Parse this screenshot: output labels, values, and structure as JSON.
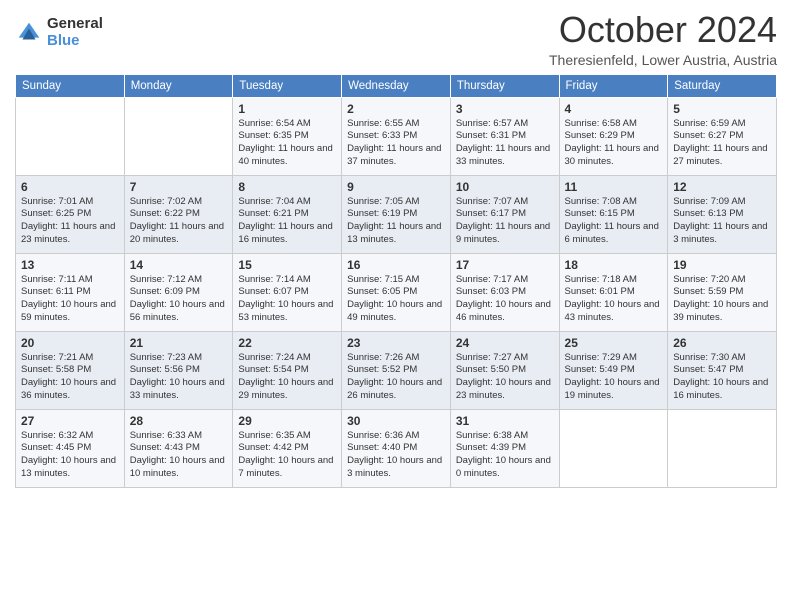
{
  "header": {
    "logo": {
      "general": "General",
      "blue": "Blue"
    },
    "title": "October 2024",
    "subtitle": "Theresienfeld, Lower Austria, Austria"
  },
  "weekdays": [
    "Sunday",
    "Monday",
    "Tuesday",
    "Wednesday",
    "Thursday",
    "Friday",
    "Saturday"
  ],
  "weeks": [
    [
      {
        "day": "",
        "sunrise": "",
        "sunset": "",
        "daylight": ""
      },
      {
        "day": "",
        "sunrise": "",
        "sunset": "",
        "daylight": ""
      },
      {
        "day": "1",
        "sunrise": "Sunrise: 6:54 AM",
        "sunset": "Sunset: 6:35 PM",
        "daylight": "Daylight: 11 hours and 40 minutes."
      },
      {
        "day": "2",
        "sunrise": "Sunrise: 6:55 AM",
        "sunset": "Sunset: 6:33 PM",
        "daylight": "Daylight: 11 hours and 37 minutes."
      },
      {
        "day": "3",
        "sunrise": "Sunrise: 6:57 AM",
        "sunset": "Sunset: 6:31 PM",
        "daylight": "Daylight: 11 hours and 33 minutes."
      },
      {
        "day": "4",
        "sunrise": "Sunrise: 6:58 AM",
        "sunset": "Sunset: 6:29 PM",
        "daylight": "Daylight: 11 hours and 30 minutes."
      },
      {
        "day": "5",
        "sunrise": "Sunrise: 6:59 AM",
        "sunset": "Sunset: 6:27 PM",
        "daylight": "Daylight: 11 hours and 27 minutes."
      }
    ],
    [
      {
        "day": "6",
        "sunrise": "Sunrise: 7:01 AM",
        "sunset": "Sunset: 6:25 PM",
        "daylight": "Daylight: 11 hours and 23 minutes."
      },
      {
        "day": "7",
        "sunrise": "Sunrise: 7:02 AM",
        "sunset": "Sunset: 6:22 PM",
        "daylight": "Daylight: 11 hours and 20 minutes."
      },
      {
        "day": "8",
        "sunrise": "Sunrise: 7:04 AM",
        "sunset": "Sunset: 6:21 PM",
        "daylight": "Daylight: 11 hours and 16 minutes."
      },
      {
        "day": "9",
        "sunrise": "Sunrise: 7:05 AM",
        "sunset": "Sunset: 6:19 PM",
        "daylight": "Daylight: 11 hours and 13 minutes."
      },
      {
        "day": "10",
        "sunrise": "Sunrise: 7:07 AM",
        "sunset": "Sunset: 6:17 PM",
        "daylight": "Daylight: 11 hours and 9 minutes."
      },
      {
        "day": "11",
        "sunrise": "Sunrise: 7:08 AM",
        "sunset": "Sunset: 6:15 PM",
        "daylight": "Daylight: 11 hours and 6 minutes."
      },
      {
        "day": "12",
        "sunrise": "Sunrise: 7:09 AM",
        "sunset": "Sunset: 6:13 PM",
        "daylight": "Daylight: 11 hours and 3 minutes."
      }
    ],
    [
      {
        "day": "13",
        "sunrise": "Sunrise: 7:11 AM",
        "sunset": "Sunset: 6:11 PM",
        "daylight": "Daylight: 10 hours and 59 minutes."
      },
      {
        "day": "14",
        "sunrise": "Sunrise: 7:12 AM",
        "sunset": "Sunset: 6:09 PM",
        "daylight": "Daylight: 10 hours and 56 minutes."
      },
      {
        "day": "15",
        "sunrise": "Sunrise: 7:14 AM",
        "sunset": "Sunset: 6:07 PM",
        "daylight": "Daylight: 10 hours and 53 minutes."
      },
      {
        "day": "16",
        "sunrise": "Sunrise: 7:15 AM",
        "sunset": "Sunset: 6:05 PM",
        "daylight": "Daylight: 10 hours and 49 minutes."
      },
      {
        "day": "17",
        "sunrise": "Sunrise: 7:17 AM",
        "sunset": "Sunset: 6:03 PM",
        "daylight": "Daylight: 10 hours and 46 minutes."
      },
      {
        "day": "18",
        "sunrise": "Sunrise: 7:18 AM",
        "sunset": "Sunset: 6:01 PM",
        "daylight": "Daylight: 10 hours and 43 minutes."
      },
      {
        "day": "19",
        "sunrise": "Sunrise: 7:20 AM",
        "sunset": "Sunset: 5:59 PM",
        "daylight": "Daylight: 10 hours and 39 minutes."
      }
    ],
    [
      {
        "day": "20",
        "sunrise": "Sunrise: 7:21 AM",
        "sunset": "Sunset: 5:58 PM",
        "daylight": "Daylight: 10 hours and 36 minutes."
      },
      {
        "day": "21",
        "sunrise": "Sunrise: 7:23 AM",
        "sunset": "Sunset: 5:56 PM",
        "daylight": "Daylight: 10 hours and 33 minutes."
      },
      {
        "day": "22",
        "sunrise": "Sunrise: 7:24 AM",
        "sunset": "Sunset: 5:54 PM",
        "daylight": "Daylight: 10 hours and 29 minutes."
      },
      {
        "day": "23",
        "sunrise": "Sunrise: 7:26 AM",
        "sunset": "Sunset: 5:52 PM",
        "daylight": "Daylight: 10 hours and 26 minutes."
      },
      {
        "day": "24",
        "sunrise": "Sunrise: 7:27 AM",
        "sunset": "Sunset: 5:50 PM",
        "daylight": "Daylight: 10 hours and 23 minutes."
      },
      {
        "day": "25",
        "sunrise": "Sunrise: 7:29 AM",
        "sunset": "Sunset: 5:49 PM",
        "daylight": "Daylight: 10 hours and 19 minutes."
      },
      {
        "day": "26",
        "sunrise": "Sunrise: 7:30 AM",
        "sunset": "Sunset: 5:47 PM",
        "daylight": "Daylight: 10 hours and 16 minutes."
      }
    ],
    [
      {
        "day": "27",
        "sunrise": "Sunrise: 6:32 AM",
        "sunset": "Sunset: 4:45 PM",
        "daylight": "Daylight: 10 hours and 13 minutes."
      },
      {
        "day": "28",
        "sunrise": "Sunrise: 6:33 AM",
        "sunset": "Sunset: 4:43 PM",
        "daylight": "Daylight: 10 hours and 10 minutes."
      },
      {
        "day": "29",
        "sunrise": "Sunrise: 6:35 AM",
        "sunset": "Sunset: 4:42 PM",
        "daylight": "Daylight: 10 hours and 7 minutes."
      },
      {
        "day": "30",
        "sunrise": "Sunrise: 6:36 AM",
        "sunset": "Sunset: 4:40 PM",
        "daylight": "Daylight: 10 hours and 3 minutes."
      },
      {
        "day": "31",
        "sunrise": "Sunrise: 6:38 AM",
        "sunset": "Sunset: 4:39 PM",
        "daylight": "Daylight: 10 hours and 0 minutes."
      },
      {
        "day": "",
        "sunrise": "",
        "sunset": "",
        "daylight": ""
      },
      {
        "day": "",
        "sunrise": "",
        "sunset": "",
        "daylight": ""
      }
    ]
  ]
}
